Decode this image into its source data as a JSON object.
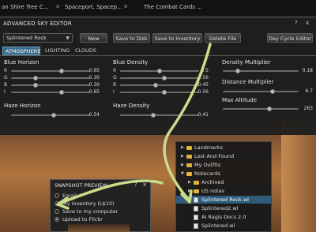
{
  "tabs": [
    {
      "label": "an Shire Tree C...",
      "close": "x"
    },
    {
      "label": "Spaceport, Spacep...",
      "close": "x"
    },
    {
      "label": "The Combat Cards ...",
      "close": ""
    }
  ],
  "editor": {
    "title": "ADVANCED SKY EDITOR",
    "help": "?",
    "close": "x",
    "preset": "Splintered Rock",
    "buttons": {
      "new": "New",
      "save_disk": "Save to Disk",
      "save_inventory": "Save to Inventory",
      "delete": "Delete File",
      "day_cycle": "Day Cycle Editor"
    },
    "subtabs": [
      "ATMOSPHERE",
      "LIGHTING",
      "CLOUDS"
    ],
    "blue_horizon": {
      "title": "Blue Horizon",
      "rows": [
        {
          "label": "R",
          "value": "0.65",
          "level": 0.65
        },
        {
          "label": "G",
          "value": "0.30",
          "level": 0.3
        },
        {
          "label": "B",
          "value": "0.30",
          "level": 0.3
        },
        {
          "label": "I",
          "value": "0.65",
          "level": 0.65
        }
      ]
    },
    "haze_horizon": {
      "title": "Haze Horizon",
      "value": "0.54",
      "level": 0.54
    },
    "blue_density": {
      "title": "Blue Density",
      "rows": [
        {
          "label": "R",
          "value": "0.5",
          "level": 0.5
        },
        {
          "label": "G",
          "value": "0.56",
          "level": 0.56
        },
        {
          "label": "B",
          "value": "0.45",
          "level": 0.45
        },
        {
          "label": "I",
          "value": "0.56",
          "level": 0.56
        }
      ]
    },
    "haze_density": {
      "title": "Haze Density",
      "value": "0.41",
      "level": 0.41
    },
    "density_multiplier": {
      "title": "Density Multiplier",
      "value": "0.18",
      "level": 0.18
    },
    "distance_multiplier": {
      "title": "Distance Multiplier",
      "value": "6.7",
      "level": 0.67
    },
    "max_altitude": {
      "title": "Max Altitude",
      "value": "263",
      "level": 0.62
    }
  },
  "snapshot": {
    "title": "SNAPSHOT PREVIEW",
    "help": "?",
    "close": "x",
    "options": [
      {
        "label": "Email",
        "selected": false
      },
      {
        "label": "My inventory (L$10)",
        "selected": false
      },
      {
        "label": "Save to my computer",
        "selected": false
      },
      {
        "label": "Upload to Flickr",
        "selected": true
      }
    ]
  },
  "inventory": {
    "items": [
      {
        "label": "Landmarks",
        "kind": "folder",
        "level": 0
      },
      {
        "label": "Lost And Found",
        "kind": "folder",
        "level": 0
      },
      {
        "label": "My Outfits",
        "kind": "folder",
        "level": 0
      },
      {
        "label": "Notecards",
        "kind": "folder-open",
        "level": 0
      },
      {
        "label": "Archived",
        "kind": "folder",
        "level": 1
      },
      {
        "label": "US notes",
        "kind": "folder",
        "level": 1
      },
      {
        "label": "Splintered Rock.wl",
        "kind": "note",
        "level": 1,
        "selected": true
      },
      {
        "label": "Splintered2.wl",
        "kind": "note",
        "level": 1
      },
      {
        "label": "AI Ragis Docs 2.0",
        "kind": "note",
        "level": 1
      },
      {
        "label": "Splintered.wl",
        "kind": "note",
        "level": 1
      }
    ]
  },
  "colors": {
    "arrow": "#c8dc8a",
    "selected_row": "#2e5b7a",
    "active_tab": "#3a6a8a",
    "folder": "#e2b33a"
  }
}
